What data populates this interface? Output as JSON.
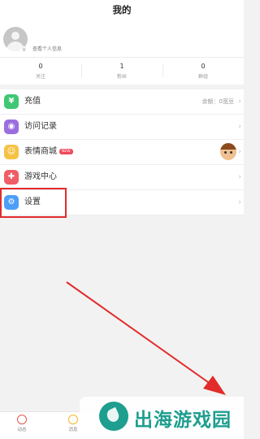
{
  "header": {
    "title": "我的"
  },
  "profile": {
    "link_text": "查看个人信息",
    "verified_mark": "V"
  },
  "stats": [
    {
      "value": "0",
      "label": "关注"
    },
    {
      "value": "1",
      "label": "粉丝"
    },
    {
      "value": "0",
      "label": "群组"
    }
  ],
  "menu": [
    {
      "label": "充值",
      "icon": "yen-icon",
      "color": "#3fc773",
      "glyph": "¥",
      "right": "余额：0宽豆"
    },
    {
      "label": "访问记录",
      "icon": "eye-icon",
      "color": "#9b6ee0",
      "glyph": "◉"
    },
    {
      "label": "表情商城",
      "icon": "emoji-icon",
      "color": "#f6c244",
      "glyph": "☺",
      "tag": "NEW"
    },
    {
      "label": "游戏中心",
      "icon": "gamepad-icon",
      "color": "#f05e67",
      "glyph": "✚"
    },
    {
      "label": "设置",
      "icon": "gear-icon",
      "color": "#4d9ff5",
      "glyph": "⚙"
    }
  ],
  "tabbar": [
    {
      "label": "动态"
    },
    {
      "label": "消息"
    }
  ],
  "watermark": {
    "text": "出海游戏园"
  },
  "colors": {
    "highlight": "#e22b2b",
    "brand": "#1e9e8f"
  }
}
